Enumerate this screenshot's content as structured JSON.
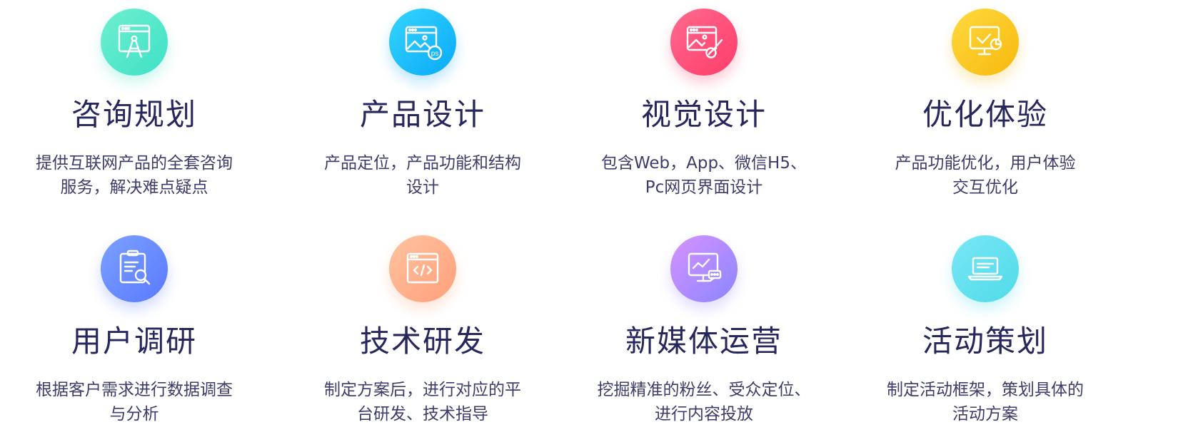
{
  "services": [
    {
      "title": "咨询规划",
      "desc_line1": "提供互联网产品的全套咨询",
      "desc_line2": "服务，解决难点疑点",
      "icon": "consulting-compass-icon",
      "color": "#4fe6c8"
    },
    {
      "title": "产品设计",
      "desc_line1": "产品定位，产品功能和结构",
      "desc_line2": "设计",
      "icon": "photoshop-design-icon",
      "color": "#14b8fb"
    },
    {
      "title": "视觉设计",
      "desc_line1": "包含Web，App、微信H5、",
      "desc_line2": "Pc网页界面设计",
      "icon": "brush-design-icon",
      "color": "#ff4a76"
    },
    {
      "title": "优化体验",
      "desc_line1": "产品功能优化，用户体验",
      "desc_line2": "交互优化",
      "icon": "monitor-check-icon",
      "color": "#f9c51d"
    },
    {
      "title": "用户调研",
      "desc_line1": "根据客户需求进行数据调查",
      "desc_line2": "与分析",
      "icon": "clipboard-search-icon",
      "color": "#6a8cff"
    },
    {
      "title": "技术研发",
      "desc_line1": "制定方案后，进行对应的平",
      "desc_line2": "台研发、技术指导",
      "icon": "code-window-icon",
      "color": "#ffae88"
    },
    {
      "title": "新媒体运营",
      "desc_line1": "挖掘精准的粉丝、受众定位、",
      "desc_line2": "进行内容投放",
      "icon": "monitor-chart-chat-icon",
      "color": "#b48cff"
    },
    {
      "title": "活动策划",
      "desc_line1": "制定活动框架，策划具体的",
      "desc_line2": "活动方案",
      "icon": "laptop-icon",
      "color": "#62e1ee"
    }
  ]
}
